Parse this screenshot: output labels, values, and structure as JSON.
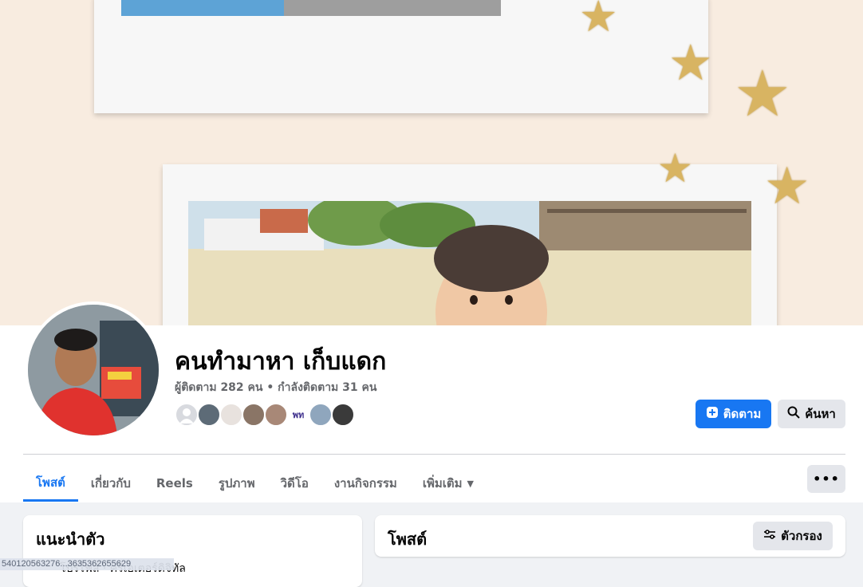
{
  "profile": {
    "name": "คนทำมาหา เก็บแดก",
    "stats": "ผู้ติดตาม 282 คน • กำลังติดตาม 31 คน"
  },
  "actions": {
    "follow_label": "ติดตาม",
    "search_label": "ค้นหา"
  },
  "tabs": [
    {
      "label": "โพสต์",
      "active": true
    },
    {
      "label": "เกี่ยวกับ"
    },
    {
      "label": "Reels"
    },
    {
      "label": "รูปภาพ"
    },
    {
      "label": "วิดีโอ"
    },
    {
      "label": "งานกิจกรรม"
    },
    {
      "label": "เพิ่มเติม"
    }
  ],
  "more_menu_label": "•••",
  "intro": {
    "title": "แนะนำตัว",
    "line": "โปรไฟล์ · ครีเอเตอร์ดิจิทัล"
  },
  "posts_section": {
    "title": "โพสต์",
    "filter_label": "ตัวกรอง"
  },
  "status_url": "540120563276...3635362655629",
  "colors": {
    "accent": "#1877f2",
    "page_bg": "#f0f2f5",
    "cover_bg": "#f8ece0",
    "star": "#d8b462"
  }
}
